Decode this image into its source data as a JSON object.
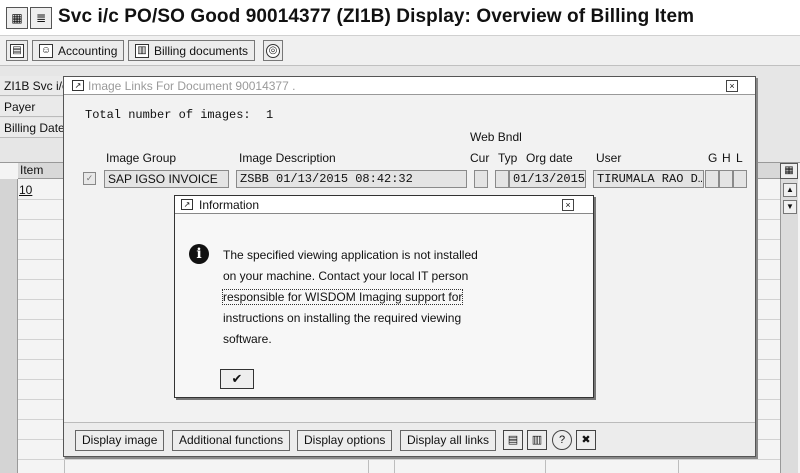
{
  "window": {
    "title": "Svc i/c PO/SO Good 90014377   (ZI1B) Display: Overview of Billing Item"
  },
  "toolbar": {
    "buttons": [
      {
        "label": "Accounting",
        "icon": "accounting-icon"
      },
      {
        "label": "Billing documents",
        "icon": "billing-documents-icon"
      }
    ]
  },
  "header_fields": {
    "doc_type": "ZI1B Svc i/c",
    "payer": "Payer",
    "billing_date": "Billing Date"
  },
  "items_table": {
    "column_item": "Item",
    "rows": [
      {
        "item": "10"
      }
    ]
  },
  "image_links_dialog": {
    "title": "Image Links For Document 90014377 .",
    "total_label": "Total number of images:",
    "total_value": "1",
    "web_bndl_label": "Web Bndl",
    "columns": {
      "image_group": "Image Group",
      "image_description": "Image Description",
      "cur": "Cur",
      "typ": "Typ",
      "org_date": "Org date",
      "user": "User",
      "g": "G",
      "h": "H",
      "l": "L"
    },
    "row": {
      "image_group": "SAP IGSO INVOICE",
      "image_description": "ZSBB 01/13/2015 08:42:32",
      "org_date": "01/13/2015",
      "user": "TIRUMALA RAO D…"
    },
    "footer_buttons": [
      {
        "label": "Display image"
      },
      {
        "label": "Additional functions"
      },
      {
        "label": "Display options"
      },
      {
        "label": "Display all links"
      }
    ],
    "footer_icons": [
      "list-icon",
      "list-detail-icon",
      "help-icon",
      "cancel-icon"
    ]
  },
  "information_dialog": {
    "title": "Information",
    "message_lines": [
      "The specified viewing application is not installed",
      "on your machine. Contact your local IT person",
      "responsible for WISDOM Imaging support for",
      "instructions on installing the required viewing",
      "software."
    ],
    "ok_symbol": "✔"
  }
}
